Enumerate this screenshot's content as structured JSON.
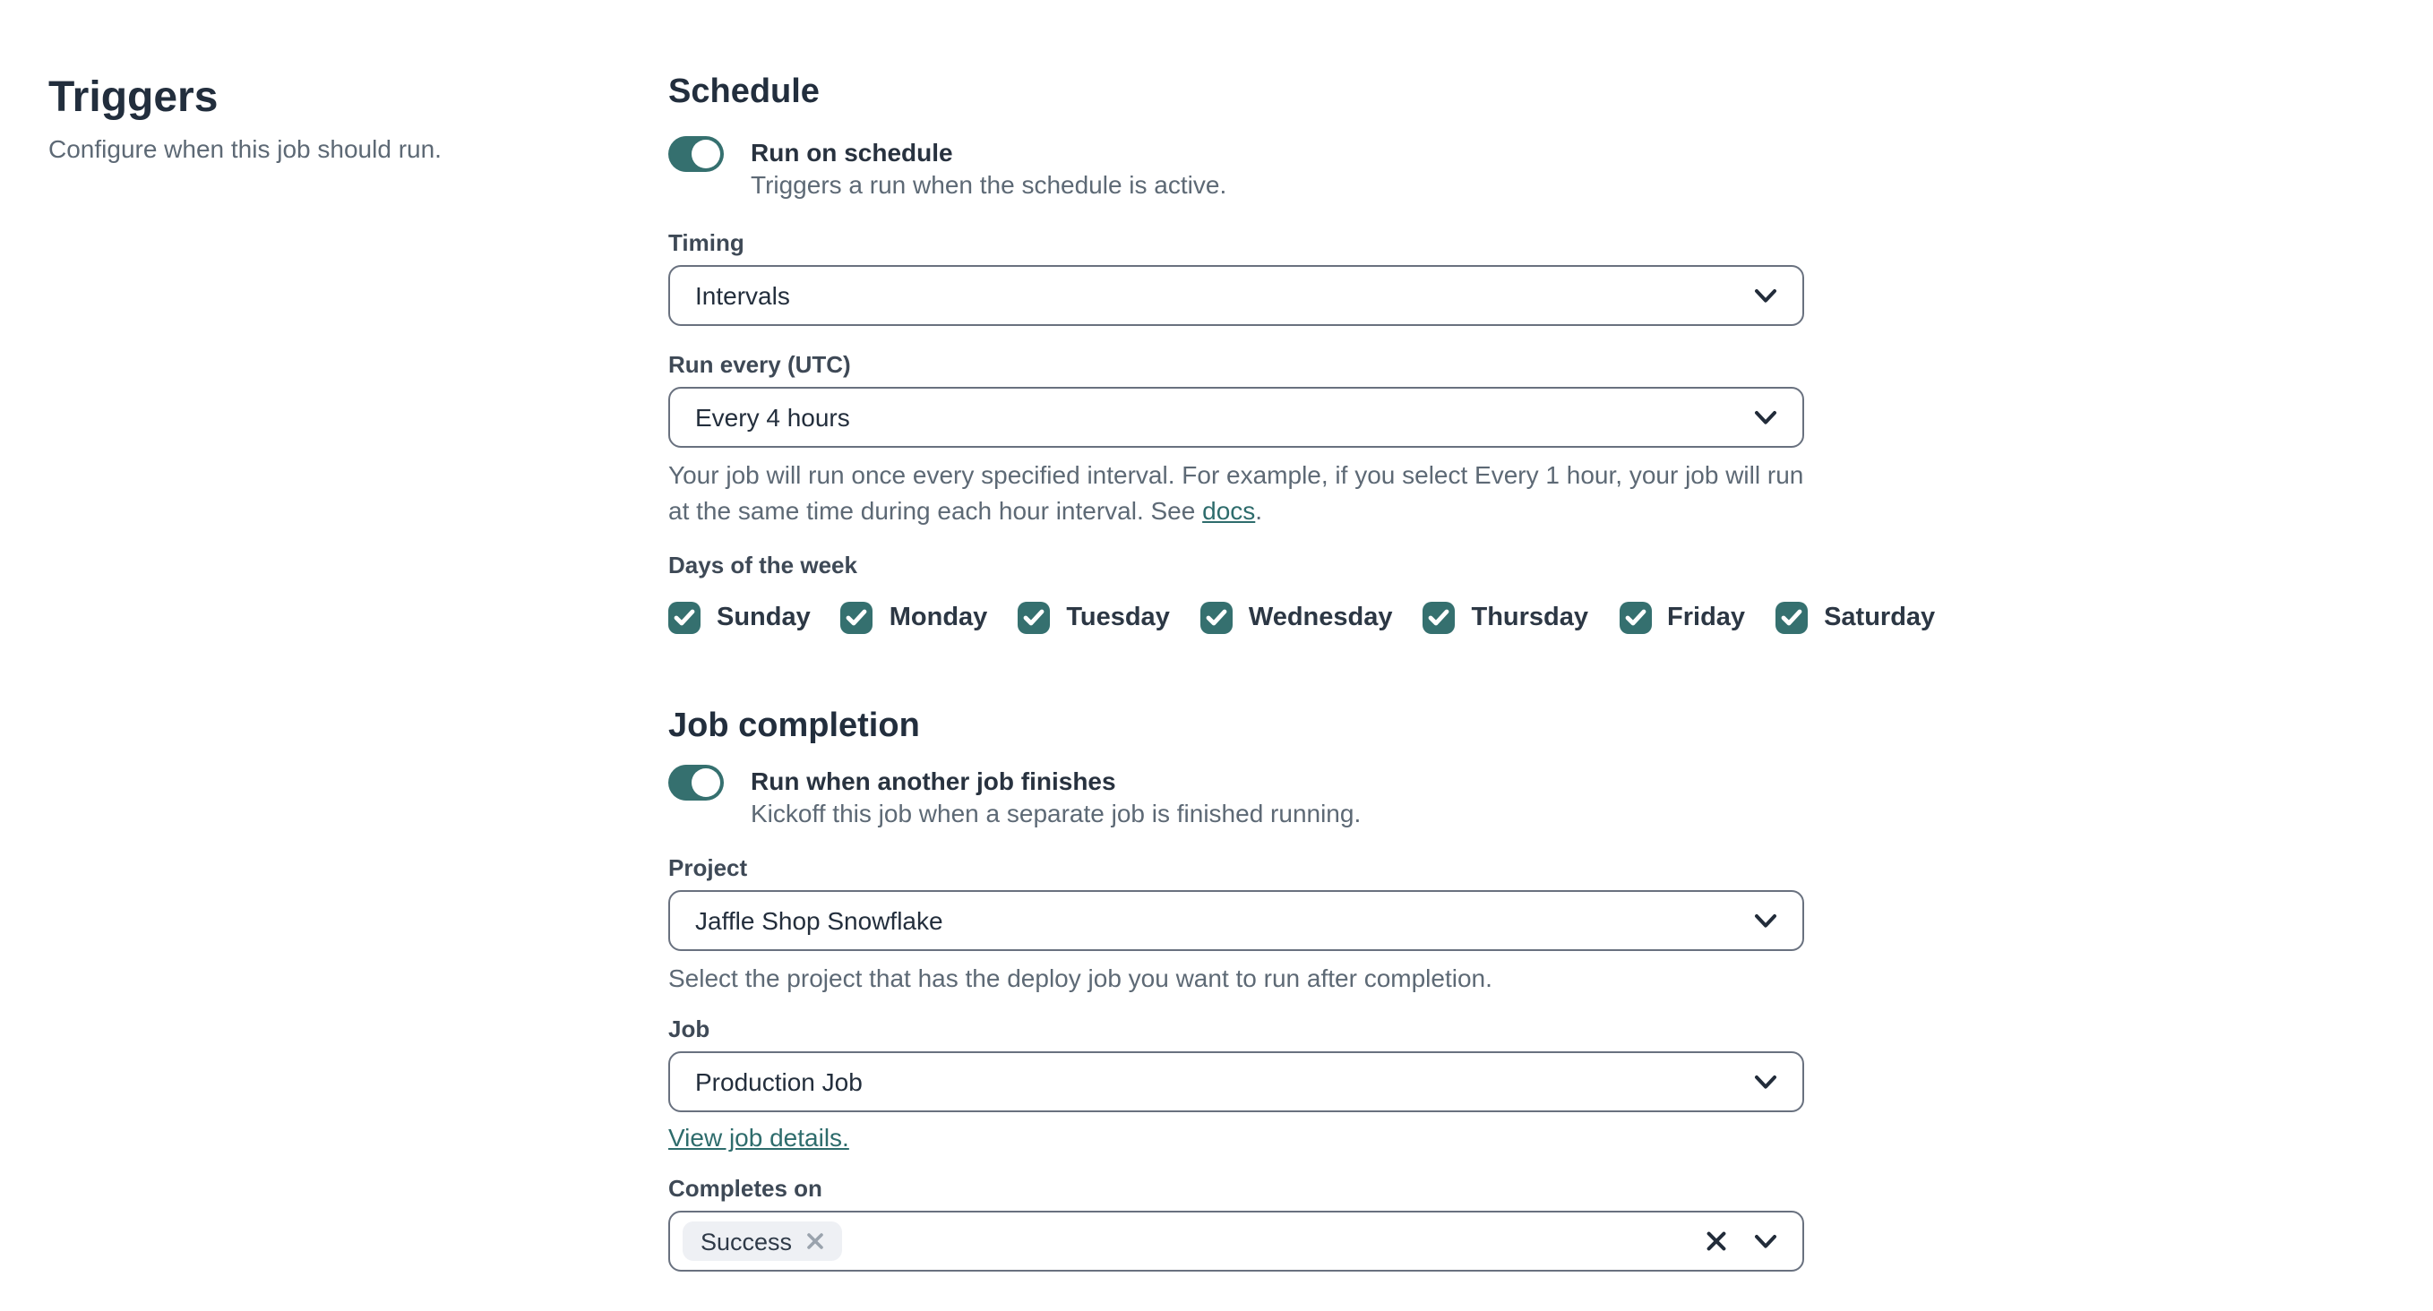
{
  "colors": {
    "teal": "#35706f",
    "heading": "#222e3d",
    "muted_text": "#5d6975",
    "input_border": "#69717f",
    "chip_background": "#eef0f4"
  },
  "left_panel": {
    "title": "Triggers",
    "subtitle": "Configure when this job should run."
  },
  "schedule": {
    "heading": "Schedule",
    "toggle": {
      "label": "Run on schedule",
      "description": "Triggers a run when the schedule is active.",
      "state": "on"
    },
    "timing": {
      "label": "Timing",
      "value": "Intervals"
    },
    "run_every": {
      "label": "Run every (UTC)",
      "value": "Every 4 hours",
      "help_prefix": "Your job will run once every specified interval. For example, if you select Every 1 hour, your job will run at the same time during each hour interval. See ",
      "help_link": "docs",
      "help_suffix": "."
    },
    "days": {
      "label": "Days of the week",
      "items": [
        {
          "label": "Sunday",
          "checked": true
        },
        {
          "label": "Monday",
          "checked": true
        },
        {
          "label": "Tuesday",
          "checked": true
        },
        {
          "label": "Wednesday",
          "checked": true
        },
        {
          "label": "Thursday",
          "checked": true
        },
        {
          "label": "Friday",
          "checked": true
        },
        {
          "label": "Saturday",
          "checked": true
        }
      ]
    }
  },
  "job_completion": {
    "heading": "Job completion",
    "toggle": {
      "label": "Run when another job finishes",
      "description": "Kickoff this job when a separate job is finished running.",
      "state": "on"
    },
    "project": {
      "label": "Project",
      "value": "Jaffle Shop Snowflake",
      "help": "Select the project that has the deploy job you want to run after completion."
    },
    "job": {
      "label": "Job",
      "value": "Production Job",
      "link": "View job details."
    },
    "completes_on": {
      "label": "Completes on",
      "chips": [
        "Success"
      ]
    }
  }
}
